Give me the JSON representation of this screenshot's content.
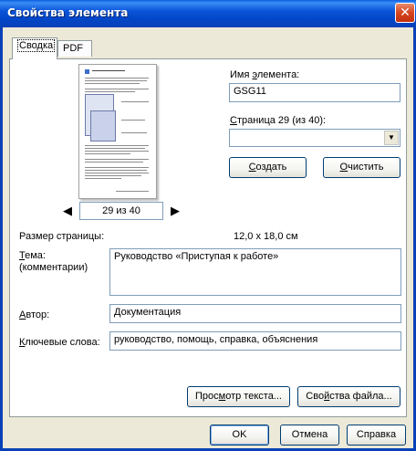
{
  "window": {
    "title": "Свойства элемента",
    "close_glyph": "✕"
  },
  "tabs": [
    {
      "label": "Сводка"
    },
    {
      "label": "PDF"
    }
  ],
  "preview": {
    "prev_glyph": "◀",
    "next_glyph": "▶",
    "page_indicator": "29 из 40"
  },
  "element_name": {
    "label_pre": "Имя ",
    "label_key": "э",
    "label_post": "лемента:",
    "value": "GSG11"
  },
  "page_select": {
    "label_pre": "",
    "label_key": "С",
    "label_post": "траница 29 (из 40):",
    "value": "",
    "arrow_glyph": "▼"
  },
  "buttons": {
    "create": {
      "pre": "",
      "key": "С",
      "post": "оздать"
    },
    "clear": {
      "pre": "",
      "key": "О",
      "post": "чистить"
    },
    "view_text": {
      "pre": "Прос",
      "key": "м",
      "post": "отр текста..."
    },
    "file_props": {
      "pre": "Сво",
      "key": "й",
      "post": "ства файла..."
    },
    "ok": "OK",
    "cancel": "Отмена",
    "help": "Справка"
  },
  "page_size": {
    "label": "Размер страницы:",
    "value": "12,0 x 18,0 см"
  },
  "subject": {
    "label_key": "Т",
    "label_post": "ема:",
    "label_line2": "(комментарии)",
    "value": "Руководство «Приступая к работе»"
  },
  "author": {
    "label_key": "А",
    "label_post": "втор:",
    "value": "Документация"
  },
  "keywords": {
    "label_key": "К",
    "label_post": "лючевые слова:",
    "value": "руководство, помощь, справка, объяснения"
  }
}
